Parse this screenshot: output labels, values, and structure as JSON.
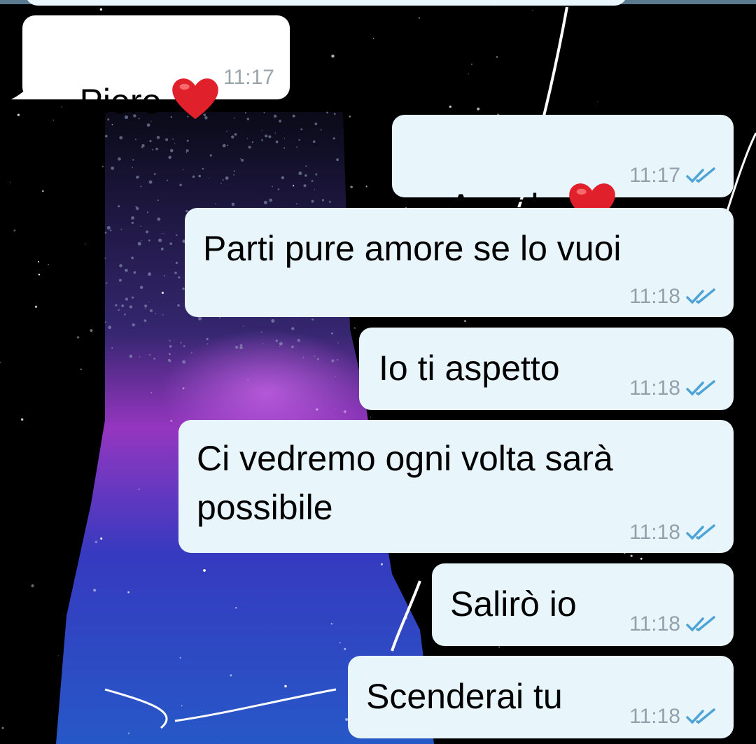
{
  "colors": {
    "incoming_bubble": "#ffffff",
    "outgoing_bubble": "#e8f6fc",
    "time_text": "#92a1ab",
    "read_ticks": "#4fa3d6",
    "heart": "#e0202a",
    "background": "#000000"
  },
  "icons": {
    "heart": "red-heart-emoji",
    "read_receipt": "double-check-icon"
  },
  "messages": [
    {
      "direction": "incoming",
      "text": "Piero",
      "emoji": "heart",
      "time": "11:17"
    },
    {
      "direction": "outgoing",
      "text": "Angela",
      "emoji": "heart",
      "time": "11:17",
      "read": true
    },
    {
      "direction": "outgoing",
      "text": "Parti pure amore se lo vuoi",
      "time": "11:18",
      "read": true
    },
    {
      "direction": "outgoing",
      "text": "Io ti aspetto",
      "time": "11:18",
      "read": true
    },
    {
      "direction": "outgoing",
      "text": "Ci vedremo ogni volta sarà\npossibile",
      "time": "11:18",
      "read": true
    },
    {
      "direction": "outgoing",
      "text": "Salirò io",
      "time": "11:18",
      "read": true
    },
    {
      "direction": "outgoing",
      "text": "Scenderai tu",
      "time": "11:18",
      "read": true
    }
  ]
}
